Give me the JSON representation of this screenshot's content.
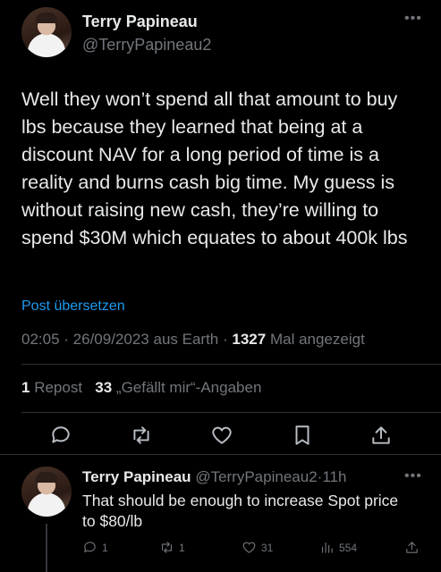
{
  "tweet": {
    "author_name": "Terry Papineau",
    "author_handle": "@TerryPapineau2",
    "text": "Well they won’t spend all that amount to buy lbs because they learned that being at a discount NAV for a long period of time is a reality and burns cash big time. My guess is without raising new cash, they’re willing to spend $30M which equates to about 400k lbs",
    "translate_label": "Post übersetzen",
    "time": "02:05",
    "date": "26/09/2023",
    "source": "aus Earth",
    "views_count": "1327",
    "views_label": "Mal angezeigt",
    "reposts_count": "1",
    "reposts_label": "Repost",
    "likes_count": "33",
    "likes_label": "„Gefällt mir“-Angaben"
  },
  "reply": {
    "author_name": "Terry Papineau",
    "author_handle": "@TerryPapineau2",
    "time": "11h",
    "text": "That should be enough to increase Spot price to $80/lb",
    "replies": "1",
    "reposts": "1",
    "likes": "31",
    "views": "554"
  },
  "icons": {
    "more": "more-horizontal-icon",
    "reply": "speech-bubble-icon",
    "repost": "repost-arrows-icon",
    "like": "heart-icon",
    "bookmark": "bookmark-icon",
    "share": "share-upload-icon",
    "views": "bar-chart-icon"
  },
  "colors": {
    "background": "#000000",
    "text": "#e7e9ea",
    "muted": "#71767b",
    "link": "#1d9bf0",
    "divider": "#2f3336"
  }
}
